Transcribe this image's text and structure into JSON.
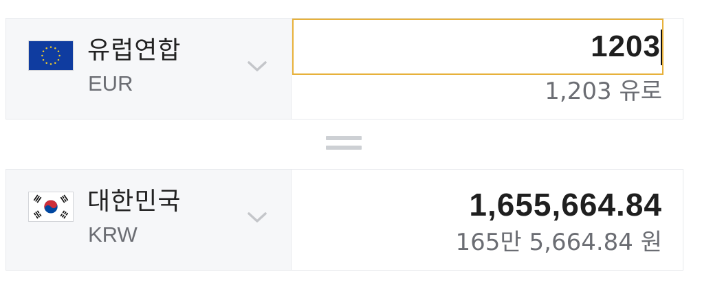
{
  "from": {
    "country": "유럽연합",
    "code": "EUR",
    "flag_icon": "eu-flag-icon",
    "amount_input": "1203",
    "amount_words": "1,203 유로"
  },
  "to": {
    "country": "대한민국",
    "code": "KRW",
    "flag_icon": "korea-flag-icon",
    "amount": "1,655,664.84",
    "amount_words": "165만 5,664.84 원"
  },
  "icons": {
    "chevron": "chevron-down-icon",
    "equals": "equals-icon"
  },
  "colors": {
    "input_focus_border": "#e7b13b",
    "selector_bg": "#f6f7f9",
    "eu_blue": "#0f3ca0",
    "eu_star": "#f2cd2b",
    "korea_red": "#cd2e3a",
    "korea_blue": "#0047a0"
  }
}
